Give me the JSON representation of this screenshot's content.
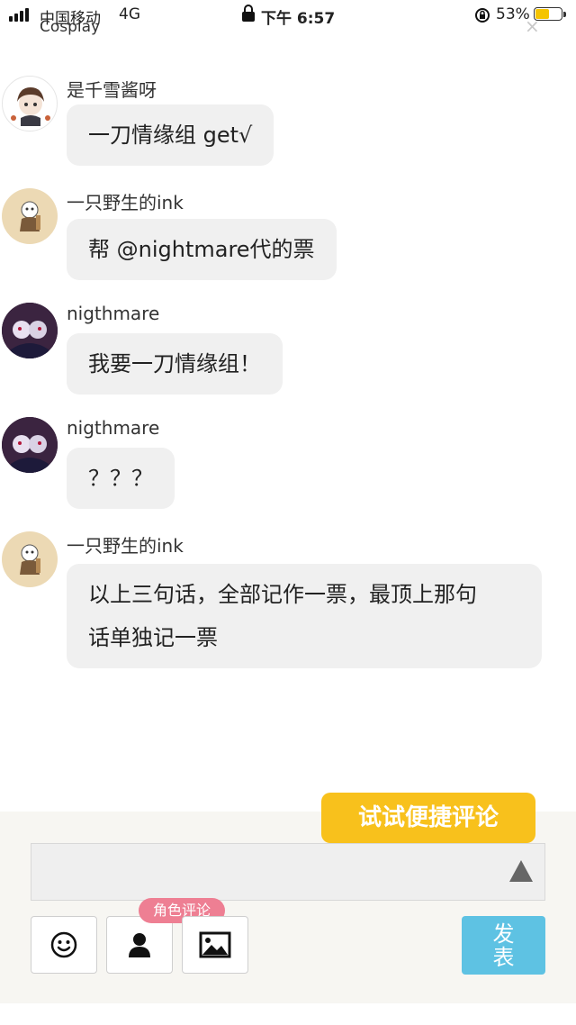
{
  "status_bar": {
    "carrier": "中国移动",
    "network": "4G",
    "time": "下午 6:57",
    "battery_percent": "53%",
    "battery_level": 0.53
  },
  "header": {
    "subtitle": "Cosplay",
    "close_symbol": "×"
  },
  "messages": [
    {
      "name": "是千雪酱呀",
      "text": "一刀情缘组 get√",
      "avatar": "anime-girl-avatar"
    },
    {
      "name": "一只野生的ink",
      "text": "帮 @nightmare代的票",
      "avatar": "ink-sans-avatar"
    },
    {
      "name": "nigthmare",
      "text": "我要一刀情缘组！",
      "avatar": "nightmare-avatar"
    },
    {
      "name": "nigthmare",
      "text": "？？？",
      "avatar": "nightmare-avatar"
    },
    {
      "name": "一只野生的ink",
      "text_lines": [
        "以上三句话，全部记作一票，最顶上那句",
        "话单独记一票"
      ],
      "avatar": "ink-sans-avatar"
    }
  ],
  "composer": {
    "tooltip": "试试便捷评论",
    "input_value": "",
    "role_badge": "角色评论",
    "send_label_line1": "发",
    "send_label_line2": "表",
    "tools": [
      "emoji-icon",
      "person-icon",
      "image-icon"
    ],
    "colors": {
      "tooltip": "#f8c11c",
      "badge": "#ee7f93",
      "send": "#5ec2e3"
    }
  }
}
